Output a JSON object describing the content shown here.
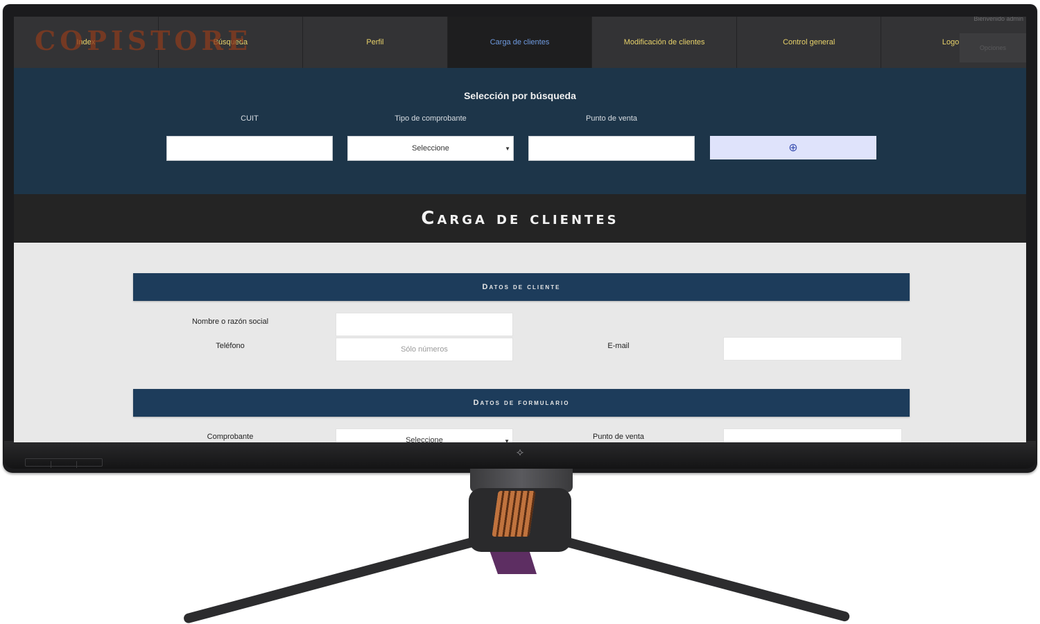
{
  "brand": {
    "logo_text": "COPISTORE"
  },
  "nav": {
    "items": [
      {
        "label": "Index"
      },
      {
        "label": "Búsqueda"
      },
      {
        "label": "Perfil"
      },
      {
        "label": "Carga de clientes",
        "active": true
      },
      {
        "label": "Modificación de clientes"
      },
      {
        "label": "Control general"
      },
      {
        "label": "Logout"
      }
    ],
    "top_right_note": "Bienvenido admin",
    "top_right_button": "Opciones"
  },
  "search": {
    "title": "Selección por búsqueda",
    "fields": {
      "cuit": {
        "label": "CUIT",
        "value": ""
      },
      "tipo_comprobante": {
        "label": "Tipo de comprobante",
        "value": "Seleccione"
      },
      "punto_venta": {
        "label": "Punto de venta",
        "value": ""
      }
    },
    "submit_icon": "globe-icon",
    "submit_glyph": "⊕"
  },
  "page_title": "Carga de clientes",
  "section_cliente": {
    "title": "Datos de cliente",
    "nombre": {
      "label": "Nombre o razón social",
      "value": ""
    },
    "telefono": {
      "label": "Teléfono",
      "placeholder": "Sólo números"
    },
    "email": {
      "label": "E-mail",
      "value": ""
    }
  },
  "section_formulario": {
    "title": "Datos de formulario",
    "comprobante": {
      "label": "Comprobante",
      "value": "Seleccione"
    },
    "punto_venta": {
      "label": "Punto de venta",
      "value": ""
    }
  },
  "colors": {
    "nav_bg": "#333335",
    "nav_text": "#e8d26a",
    "nav_active_text": "#6f9be0",
    "search_band": "#1d3549",
    "title_band": "#242424",
    "section_bar": "#1d3c5b",
    "button_bg": "#dfe3fb"
  },
  "monitor": {
    "logo_icon": "rog-logo-icon"
  }
}
